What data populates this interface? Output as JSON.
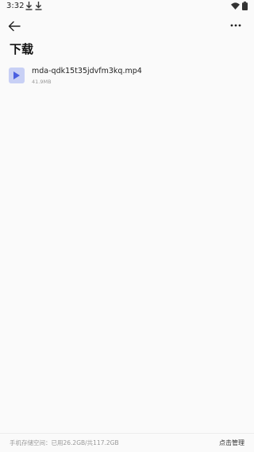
{
  "status_bar": {
    "time": "3:32",
    "icons": [
      "download-icon",
      "download-icon",
      "wifi-icon",
      "battery-icon"
    ]
  },
  "toolbar": {
    "back_icon": "back-arrow-icon",
    "more_icon": "more-options-icon"
  },
  "page": {
    "title": "下载"
  },
  "files": [
    {
      "name": "mda-qdk15t35jdvfm3kq.mp4",
      "size": "41.9MB",
      "icon": "video-file-icon"
    }
  ],
  "footer": {
    "storage_text": "手机存储空间：已用26.2GB/共117.2GB",
    "manage_label": "点击管理"
  },
  "colors": {
    "background": "#fafafa",
    "file_icon_bg": "#c8d0f5",
    "file_icon_play": "#4a5fe0",
    "secondary_text": "#999999"
  }
}
